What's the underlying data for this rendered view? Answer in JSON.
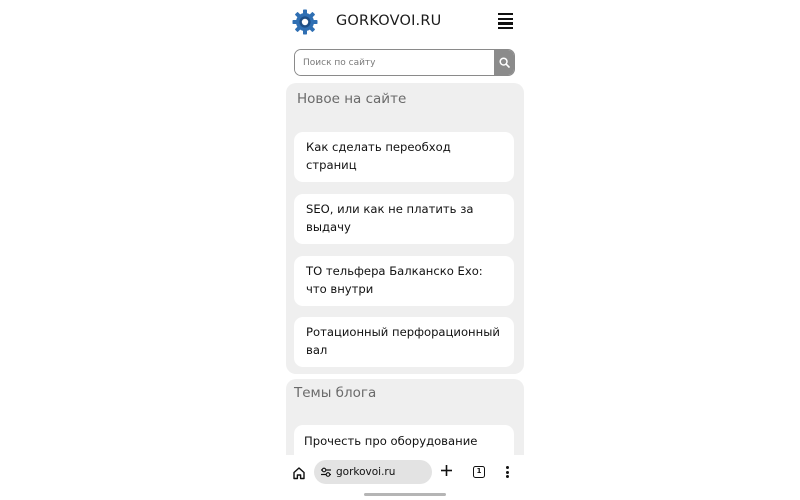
{
  "header": {
    "site_name": "GORKOVOI.RU",
    "logo_icon": "gear-icon",
    "menu_icon": "hamburger-menu-icon"
  },
  "search": {
    "placeholder": "Поиск по сайту",
    "value": "",
    "button_icon": "search-icon"
  },
  "new_on_site": {
    "title": "Новое на сайте",
    "items": [
      {
        "label": "Как сделать переобход страниц"
      },
      {
        "label": "SEO, или как не платить за выдачу"
      },
      {
        "label": "ТО тельфера Балканско Ехо: что внутри"
      },
      {
        "label": "Ротационный перфорационный вал"
      }
    ]
  },
  "blog_topics": {
    "title": "Темы блога",
    "items": [
      {
        "label": "Прочесть про оборудование"
      }
    ]
  },
  "browser_bar": {
    "url": "gorkovoi.ru",
    "tab_count": "1",
    "home_icon": "home-icon",
    "site_settings_icon": "site-settings-icon",
    "new_tab_icon": "plus-icon",
    "tabs_icon": "tabs-icon",
    "more_icon": "more-vertical-icon"
  },
  "colors": {
    "panel_bg": "#efefef",
    "card_bg": "#ffffff",
    "logo_blue": "#2f6fb3",
    "search_button_bg": "#8b8b8b",
    "url_pill_bg": "#e3e3e3"
  }
}
